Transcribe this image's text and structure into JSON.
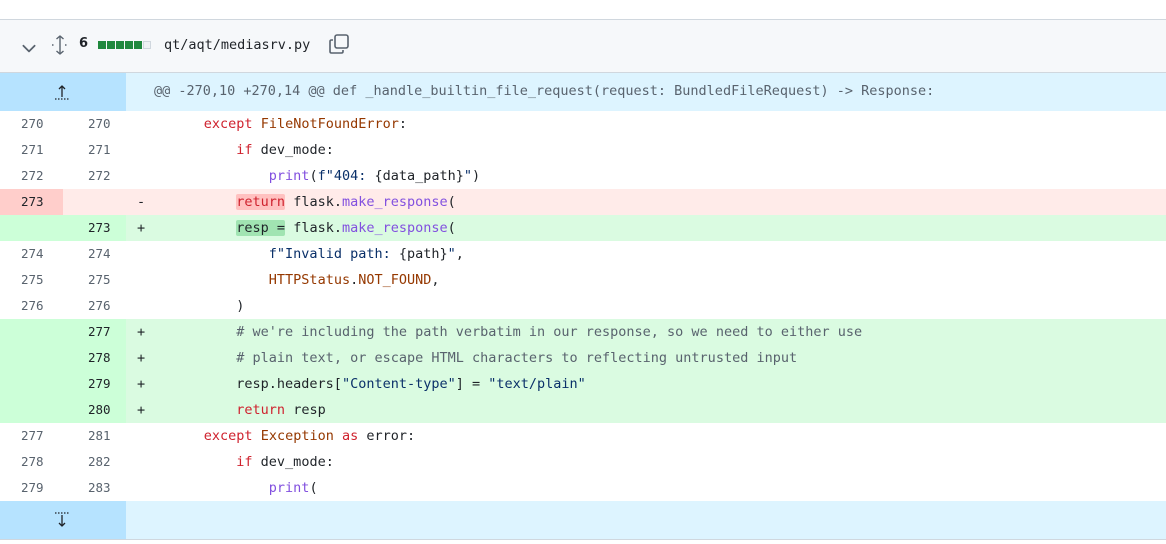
{
  "file": {
    "changes_count": "6",
    "path": "qt/aqt/mediasrv.py",
    "diffstat_colors": [
      "#1f883d",
      "#1f883d",
      "#1f883d",
      "#1f883d",
      "#1f883d",
      "#eff2f5"
    ],
    "icons": {
      "collapse": "chevron-down-icon",
      "expand_all": "unfold-icon",
      "copy": "copy-icon"
    }
  },
  "hunk_header": "@@ -270,10 +270,14 @@ def _handle_builtin_file_request(request: BundledFileRequest) -> Response:",
  "lines": [
    {
      "type": "ctx",
      "old": "270",
      "new": "270",
      "mark": "",
      "parts": [
        [
          "      ",
          ""
        ],
        [
          "except",
          "kw"
        ],
        [
          " ",
          ""
        ],
        [
          "FileNotFoundError",
          "cls"
        ],
        [
          ":",
          ""
        ]
      ]
    },
    {
      "type": "ctx",
      "old": "271",
      "new": "271",
      "mark": "",
      "parts": [
        [
          "          ",
          ""
        ],
        [
          "if",
          "kw"
        ],
        [
          " dev_mode:",
          ""
        ]
      ]
    },
    {
      "type": "ctx",
      "old": "272",
      "new": "272",
      "mark": "",
      "parts": [
        [
          "              ",
          ""
        ],
        [
          "print",
          "blt"
        ],
        [
          "(",
          ""
        ],
        [
          "f\"404: ",
          "str"
        ],
        [
          "{data_path}",
          ""
        ],
        [
          "\"",
          "str"
        ],
        [
          ")",
          ""
        ]
      ]
    },
    {
      "type": "del",
      "old": "273",
      "new": "",
      "mark": "-",
      "parts": [
        [
          "          ",
          ""
        ],
        [
          "return",
          "kw hl-del"
        ],
        [
          " flask.",
          ""
        ],
        [
          "make_response",
          "fn"
        ],
        [
          "(",
          ""
        ]
      ]
    },
    {
      "type": "add",
      "old": "",
      "new": "273",
      "mark": "+",
      "parts": [
        [
          "          ",
          ""
        ],
        [
          "resp =",
          "hl-add"
        ],
        [
          " flask.",
          ""
        ],
        [
          "make_response",
          "fn"
        ],
        [
          "(",
          ""
        ]
      ]
    },
    {
      "type": "ctx",
      "old": "274",
      "new": "274",
      "mark": "",
      "parts": [
        [
          "              ",
          ""
        ],
        [
          "f\"Invalid path: ",
          "str"
        ],
        [
          "{path}",
          ""
        ],
        [
          "\"",
          "str"
        ],
        [
          ",",
          ""
        ]
      ]
    },
    {
      "type": "ctx",
      "old": "275",
      "new": "275",
      "mark": "",
      "parts": [
        [
          "              ",
          ""
        ],
        [
          "HTTPStatus",
          "cls"
        ],
        [
          ".",
          ""
        ],
        [
          "NOT_FOUND",
          "cls"
        ],
        [
          ",",
          ""
        ]
      ]
    },
    {
      "type": "ctx",
      "old": "276",
      "new": "276",
      "mark": "",
      "parts": [
        [
          "          )",
          ""
        ]
      ]
    },
    {
      "type": "add",
      "old": "",
      "new": "277",
      "mark": "+",
      "parts": [
        [
          "          ",
          ""
        ],
        [
          "# we're including the path verbatim in our response, so we need to either use",
          "cm"
        ]
      ]
    },
    {
      "type": "add",
      "old": "",
      "new": "278",
      "mark": "+",
      "parts": [
        [
          "          ",
          ""
        ],
        [
          "# plain text, or escape HTML characters to reflecting untrusted input",
          "cm"
        ]
      ]
    },
    {
      "type": "add",
      "old": "",
      "new": "279",
      "mark": "+",
      "parts": [
        [
          "          resp.headers[",
          ""
        ],
        [
          "\"Content-type\"",
          "str"
        ],
        [
          "] = ",
          ""
        ],
        [
          "\"text/plain\"",
          "str"
        ]
      ]
    },
    {
      "type": "add",
      "old": "",
      "new": "280",
      "mark": "+",
      "parts": [
        [
          "          ",
          ""
        ],
        [
          "return",
          "kw"
        ],
        [
          " resp",
          ""
        ]
      ]
    },
    {
      "type": "ctx",
      "old": "277",
      "new": "281",
      "mark": "",
      "parts": [
        [
          "      ",
          ""
        ],
        [
          "except",
          "kw"
        ],
        [
          " ",
          ""
        ],
        [
          "Exception",
          "cls"
        ],
        [
          " ",
          ""
        ],
        [
          "as",
          "kw"
        ],
        [
          " error:",
          ""
        ]
      ]
    },
    {
      "type": "ctx",
      "old": "278",
      "new": "282",
      "mark": "",
      "parts": [
        [
          "          ",
          ""
        ],
        [
          "if",
          "kw"
        ],
        [
          " dev_mode:",
          ""
        ]
      ]
    },
    {
      "type": "ctx",
      "old": "279",
      "new": "283",
      "mark": "",
      "parts": [
        [
          "              ",
          ""
        ],
        [
          "print",
          "blt"
        ],
        [
          "(",
          ""
        ]
      ]
    }
  ]
}
